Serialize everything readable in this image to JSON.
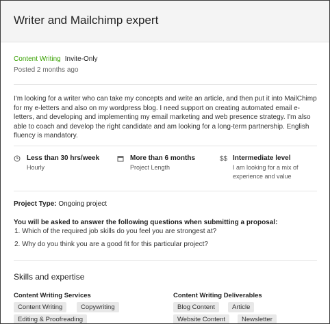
{
  "header": {
    "title": "Writer and Mailchimp expert"
  },
  "job": {
    "category": "Content Writing",
    "visibility": "Invite-Only",
    "posted": "Posted 2 months ago",
    "description": "I'm looking for a writer who can take my concepts and write an article, and then put it into MailChimp for my e-letters and also on my wordpress blog. I need support on creating automated email e-letters, and developing and implementing my email marketing and web presence strategy.   I'm also able to coach and develop the right candidate and am looking for a long-term partnership. English fluency is mandatory."
  },
  "facts": [
    {
      "icon": "clock-icon",
      "main": "Less than 30 hrs/week",
      "sub": "Hourly"
    },
    {
      "icon": "calendar-icon",
      "main": "More than 6 months",
      "sub": "Project Length"
    },
    {
      "icon": "dollar-icon",
      "glyph": "$$",
      "main": "Intermediate level",
      "sub1": "I am looking for a mix of",
      "sub2": "experience and value"
    }
  ],
  "project_type": {
    "label": "Project Type:",
    "value": "Ongoing project"
  },
  "questions": {
    "intro": "You will be asked to answer the following questions when submitting a proposal:",
    "items": [
      "1. Which of the required job skills do you feel you are strongest at?",
      "2. Why do you think you are a good fit for this particular project?"
    ]
  },
  "skills": {
    "title": "Skills and expertise",
    "groups": [
      {
        "title": "Content Writing Services",
        "chips": [
          "Content Writing",
          "Copywriting",
          "Editing & Proofreading"
        ]
      },
      {
        "title": "Content Writing Deliverables",
        "chips": [
          "Blog Content",
          "Article",
          "Website Content",
          "Newsletter"
        ]
      }
    ]
  },
  "colors": {
    "accent": "#37a000",
    "chip_bg": "#e8e8e8",
    "header_bg": "#f4f4f4"
  }
}
